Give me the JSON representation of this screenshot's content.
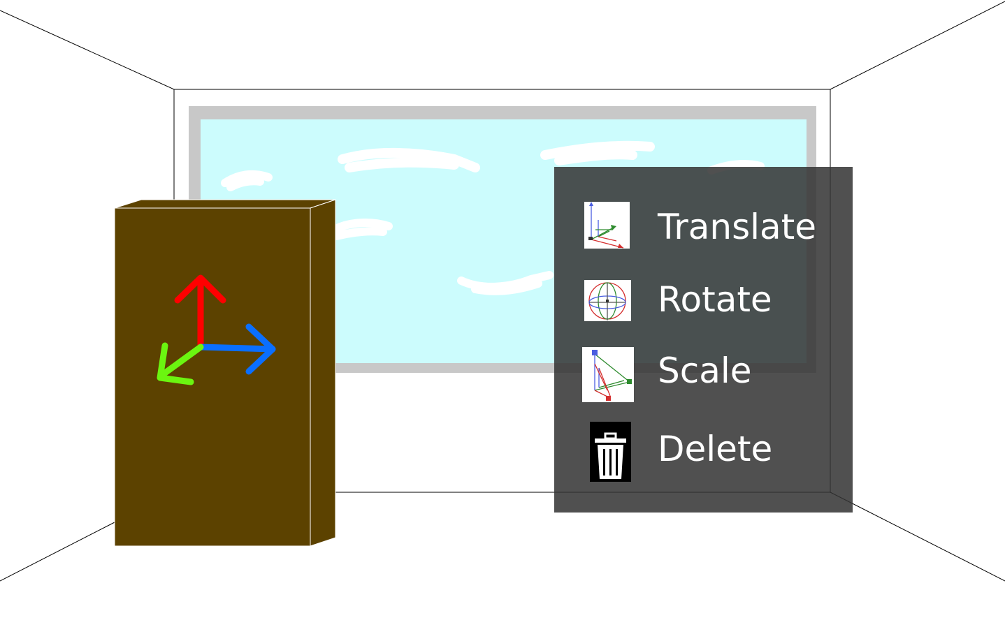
{
  "colors": {
    "sky": "#ccfcfd",
    "window_frame": "#c8c8c8",
    "cabinet_front": "#5c4200",
    "axis_up": "#ff0000",
    "axis_right": "#0a6fff",
    "axis_forward": "#6bf510",
    "menu_background": "#333333",
    "menu_text": "#ffffff"
  },
  "context_menu": {
    "items": [
      {
        "id": "translate",
        "label": "Translate",
        "icon": "translate-gizmo-icon"
      },
      {
        "id": "rotate",
        "label": "Rotate",
        "icon": "rotate-gizmo-icon"
      },
      {
        "id": "scale",
        "label": "Scale",
        "icon": "scale-gizmo-icon"
      },
      {
        "id": "delete",
        "label": "Delete",
        "icon": "trash-icon"
      }
    ]
  }
}
